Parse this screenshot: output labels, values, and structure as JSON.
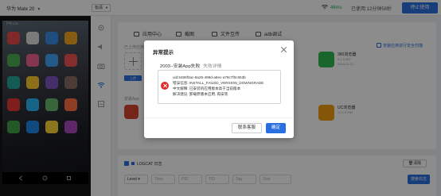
{
  "topbar": {
    "device_name": "华为 Mate 20",
    "quality": "标清",
    "wifi_speed": "46ms",
    "usage_label": "已使用:",
    "usage_time": "12分钟58秒",
    "stop_button": "停止使用"
  },
  "phone": {
    "status_time": "下午1:20",
    "apps": [
      {
        "icon": "app-icon",
        "color": "#e84b4b"
      },
      {
        "icon": "app-icon",
        "color": "#e0e0e0"
      },
      {
        "icon": "app-icon",
        "color": "#3a8ee6"
      },
      {
        "icon": "app-icon",
        "color": "#f5a623"
      },
      {
        "icon": "app-icon",
        "color": "#4caf50"
      },
      {
        "icon": "app-icon",
        "color": "#f06292"
      },
      {
        "icon": "app-icon",
        "color": "#42a5f5"
      },
      {
        "icon": "app-icon",
        "color": "#ef5350"
      },
      {
        "icon": "app-icon",
        "color": "#26a69a"
      },
      {
        "icon": "app-icon",
        "color": "#ffca28"
      },
      {
        "icon": "app-icon",
        "color": "#7e57c2"
      },
      {
        "icon": "app-icon",
        "color": "#8d6e63"
      },
      {
        "icon": "app-icon",
        "color": "#e53935"
      },
      {
        "icon": "app-icon",
        "color": "#29b6f6"
      },
      {
        "icon": "app-icon",
        "color": "#66bb6a"
      },
      {
        "icon": "app-icon",
        "color": "#ff7043"
      },
      {
        "icon": "app-icon",
        "color": "#43a047"
      },
      {
        "icon": "app-icon",
        "color": "#1e88e5"
      },
      {
        "icon": "app-icon",
        "color": "#fdd835"
      },
      {
        "icon": "app-icon",
        "color": "#ab47bc"
      }
    ]
  },
  "tabs": [
    {
      "label": "应用中心"
    },
    {
      "label": "截图"
    },
    {
      "label": "文件互传"
    },
    {
      "label": "adb调试"
    }
  ],
  "safe_check_label": "安装应用进行安全扫描",
  "section_installed": "已上传应用",
  "section_recent": "安装App",
  "upload_btn": "上传",
  "right_apps": [
    {
      "name": "360浏览器",
      "sub1": "9.1.0.302",
      "sub2": "2018-01-21",
      "color": "#2fb84f"
    },
    {
      "name": "UC浏览器",
      "sub1": "12.1.0.990",
      "color": "#f39c12"
    }
  ],
  "logcat": {
    "title": "LOGCAT 日志",
    "clear": "清除",
    "level_label": "Level",
    "filters": {
      "time": "Time",
      "pid": "PID",
      "tid": "TID",
      "tag": "Tag",
      "text": "Text"
    },
    "search": "搜索日志"
  },
  "modal": {
    "title": "异常提示",
    "heading": "2003--安装App失败",
    "detail_link": "失败详情",
    "lines": [
      "uid:6486f3ac-8a26-499d-a8ec-a79c7f0c653b",
      "错误信息: INSTALL_FAILED_VERSION_DOWNGRADE",
      "中文解释: 已安装的应用版本高于当前版本",
      "解决建议: 卸载原版本应用, 再安装"
    ],
    "contact_button": "联系客服",
    "ok_button": "确定"
  },
  "colors": {
    "primary": "#2a6fe0",
    "error": "#e02a2a",
    "success": "#21b35c"
  }
}
